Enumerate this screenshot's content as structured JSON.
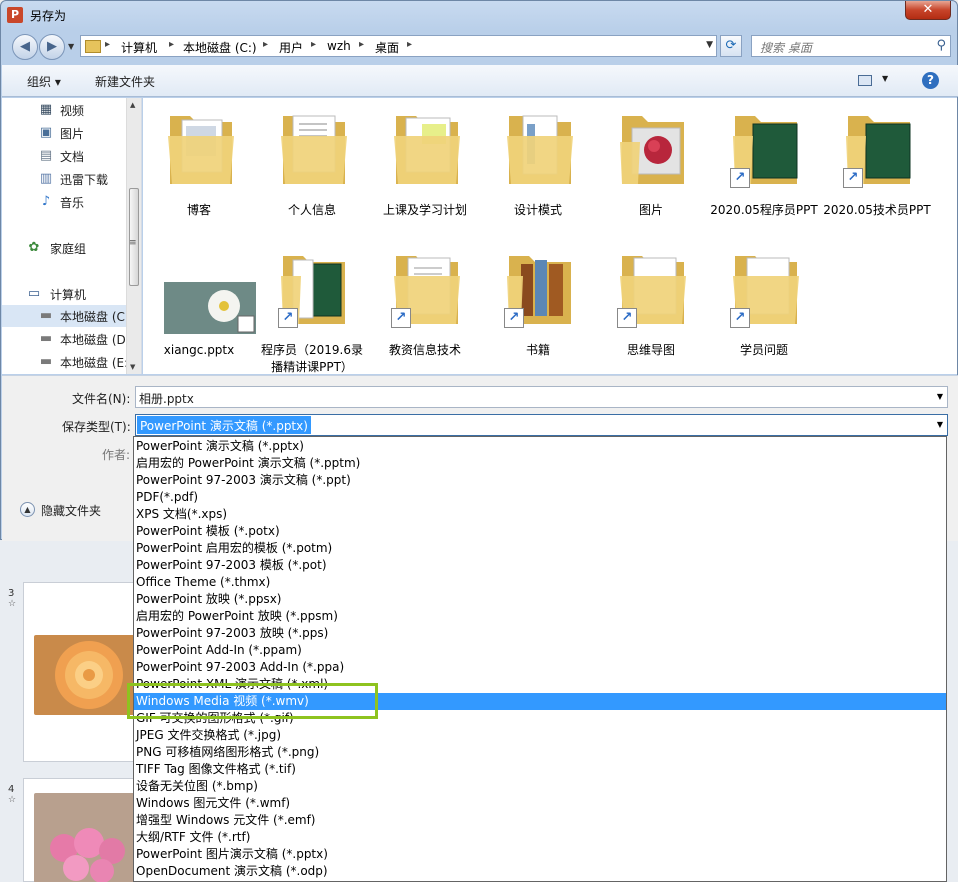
{
  "window": {
    "title": "另存为",
    "app_icon_letter": "P",
    "close_glyph": "✕"
  },
  "nav": {
    "breadcrumbs": [
      "计算机",
      "本地磁盘 (C:)",
      "用户",
      "wzh",
      "桌面"
    ],
    "separator": "▸",
    "search_placeholder": "搜索 桌面"
  },
  "toolbar": {
    "organize_label": "组织 ▾",
    "new_folder_label": "新建文件夹"
  },
  "sidebar": {
    "items": [
      {
        "label": "视频",
        "icon": "video-icon",
        "glyph": "▦"
      },
      {
        "label": "图片",
        "icon": "pictures-icon",
        "glyph": "▣"
      },
      {
        "label": "文档",
        "icon": "documents-icon",
        "glyph": "▤"
      },
      {
        "label": "迅雷下载",
        "icon": "download-icon",
        "glyph": "▥"
      },
      {
        "label": "音乐",
        "icon": "music-icon",
        "glyph": "♪"
      },
      {
        "label": "家庭组",
        "icon": "homegroup-icon",
        "glyph": "✿"
      },
      {
        "label": "计算机",
        "icon": "computer-icon",
        "glyph": "▭"
      },
      {
        "label": "本地磁盘 (C",
        "icon": "drive-icon",
        "glyph": "▬"
      },
      {
        "label": "本地磁盘 (D",
        "icon": "drive-icon",
        "glyph": "▬"
      },
      {
        "label": "本地磁盘 (E:",
        "icon": "drive-icon",
        "glyph": "▬"
      }
    ]
  },
  "files": [
    {
      "name": "博客",
      "kind": "folder",
      "shortcut": false
    },
    {
      "name": "个人信息",
      "kind": "folder",
      "shortcut": false
    },
    {
      "name": "上课及学习计划",
      "kind": "folder",
      "shortcut": false
    },
    {
      "name": "设计模式",
      "kind": "folder",
      "shortcut": false
    },
    {
      "name": "图片",
      "kind": "folder-photo",
      "shortcut": false
    },
    {
      "name": "2020.05程序员PPT",
      "kind": "folder-green",
      "shortcut": true
    },
    {
      "name": "2020.05技术员PPT",
      "kind": "folder-green",
      "shortcut": true
    },
    {
      "name": "xiangc.pptx",
      "kind": "pptx",
      "shortcut": false
    },
    {
      "name": "程序员（2019.6录播精讲课PPT）",
      "kind": "folder-green",
      "shortcut": true
    },
    {
      "name": "教资信息技术",
      "kind": "folder",
      "shortcut": true
    },
    {
      "name": "书籍",
      "kind": "folder-books",
      "shortcut": true
    },
    {
      "name": "思维导图",
      "kind": "folder",
      "shortcut": true
    },
    {
      "name": "学员问题",
      "kind": "folder",
      "shortcut": true
    }
  ],
  "form": {
    "filename_label": "文件名(N):",
    "filename_value": "相册.pptx",
    "filetype_label": "保存类型(T):",
    "filetype_value": "PowerPoint 演示文稿 (*.pptx)",
    "author_label": "作者:",
    "hide_folders_label": "隐藏文件夹"
  },
  "filetype_options": [
    "PowerPoint 演示文稿 (*.pptx)",
    "启用宏的 PowerPoint 演示文稿 (*.pptm)",
    "PowerPoint 97-2003 演示文稿 (*.ppt)",
    "PDF(*.pdf)",
    "XPS 文档(*.xps)",
    "PowerPoint 模板 (*.potx)",
    "PowerPoint 启用宏的模板 (*.potm)",
    "PowerPoint 97-2003 模板 (*.pot)",
    "Office Theme (*.thmx)",
    "PowerPoint 放映 (*.ppsx)",
    "启用宏的 PowerPoint 放映 (*.ppsm)",
    "PowerPoint 97-2003 放映 (*.pps)",
    "PowerPoint Add-In (*.ppam)",
    "PowerPoint 97-2003 Add-In (*.ppa)",
    "PowerPoint XML 演示文稿 (*.xml)",
    "Windows Media 视频 (*.wmv)",
    "GIF 可交换的图形格式 (*.gif)",
    "JPEG 文件交换格式 (*.jpg)",
    "PNG 可移植网络图形格式 (*.png)",
    "TIFF Tag 图像文件格式 (*.tif)",
    "设备无关位图 (*.bmp)",
    "Windows 图元文件 (*.wmf)",
    "增强型 Windows 元文件 (*.emf)",
    "大纲/RTF 文件 (*.rtf)",
    "PowerPoint 图片演示文稿 (*.pptx)",
    "OpenDocument 演示文稿 (*.odp)"
  ],
  "filetype_selected_index": 15,
  "slides": [
    {
      "number": "3",
      "star": "☆"
    },
    {
      "number": "4",
      "star": "☆"
    }
  ],
  "colors": {
    "selection": "#3399ff",
    "highlight_box": "#8ec31f",
    "folder": "#e8c86a"
  }
}
